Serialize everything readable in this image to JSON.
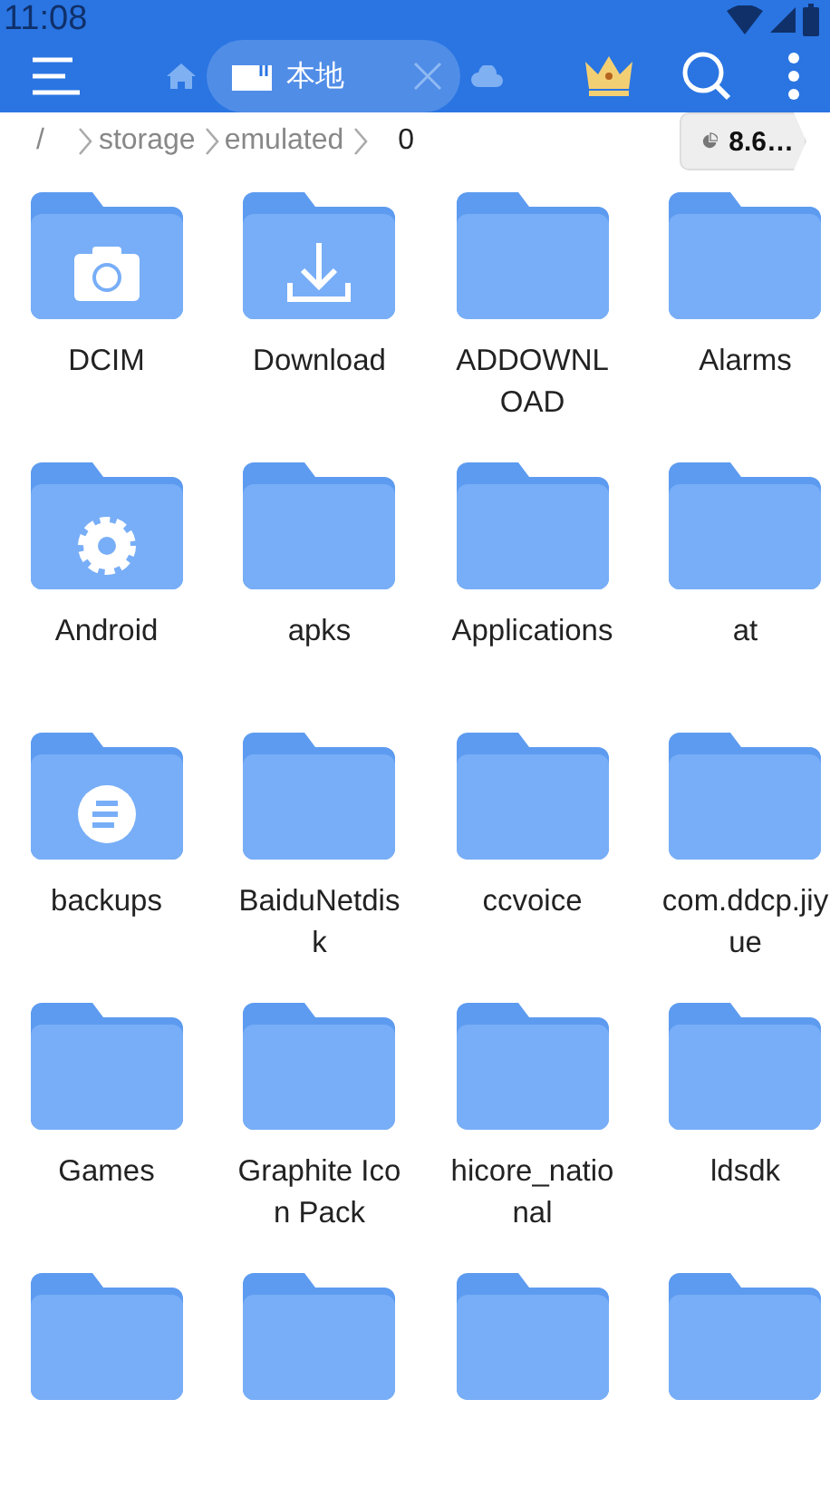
{
  "status_bar": {
    "time": "11:08"
  },
  "toolbar": {
    "tab": {
      "label": "本地",
      "selected": true
    }
  },
  "breadcrumb": {
    "segments": [
      "/",
      "storage",
      "emulated",
      "0"
    ],
    "storage_badge": "8.6…"
  },
  "folders": [
    {
      "name": "DCIM",
      "kind": "camera"
    },
    {
      "name": "Download",
      "kind": "download"
    },
    {
      "name": "ADDOWNLOAD",
      "kind": "plain"
    },
    {
      "name": "Alarms",
      "kind": "plain"
    },
    {
      "name": "Android",
      "kind": "gear"
    },
    {
      "name": "apks",
      "kind": "plain"
    },
    {
      "name": "Applications",
      "kind": "plain"
    },
    {
      "name": "at",
      "kind": "plain"
    },
    {
      "name": "backups",
      "kind": "es"
    },
    {
      "name": "BaiduNetdisk",
      "kind": "plain"
    },
    {
      "name": "ccvoice",
      "kind": "plain"
    },
    {
      "name": "com.ddcp.jiyue",
      "kind": "plain"
    },
    {
      "name": "Games",
      "kind": "plain"
    },
    {
      "name": "Graphite Icon Pack",
      "kind": "plain"
    },
    {
      "name": "hicore_national",
      "kind": "plain"
    },
    {
      "name": "ldsdk",
      "kind": "plain"
    },
    {
      "kind": "plain"
    },
    {
      "kind": "plain"
    },
    {
      "kind": "plain"
    },
    {
      "kind": "plain"
    }
  ]
}
